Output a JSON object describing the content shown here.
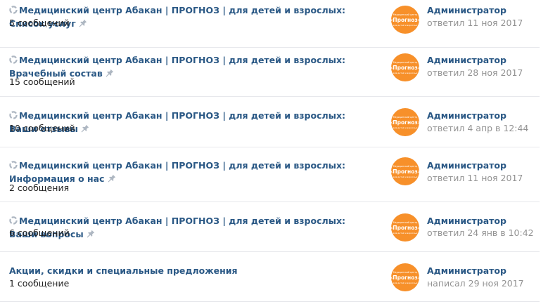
{
  "topics": [
    {
      "title": "Медицинский центр Абакан | ПРОГНОЗ | для детей и взрослых: Список услуг",
      "count": "5 сообщений",
      "author": "Администратор",
      "date": "ответил 11 ноя 2017",
      "has_poll_icon": true,
      "pinned": true
    },
    {
      "title": "Медицинский центр Абакан | ПРОГНОЗ | для детей и взрослых: Врачебный состав",
      "count": "15 сообщений",
      "author": "Администратор",
      "date": "ответил 28 ноя 2017",
      "has_poll_icon": true,
      "pinned": true
    },
    {
      "title": "Медицинский центр Абакан | ПРОГНОЗ | для детей и взрослых: Ваши отзывы",
      "count": "10 сообщений",
      "author": "Администратор",
      "date": "ответил 4 апр в 12:44",
      "has_poll_icon": true,
      "pinned": true
    },
    {
      "title": "Медицинский центр Абакан | ПРОГНОЗ | для детей и взрослых: Информация о нас",
      "count": "2 сообщения",
      "author": "Администратор",
      "date": "ответил 11 ноя 2017",
      "has_poll_icon": true,
      "pinned": true
    },
    {
      "title": "Медицинский центр Абакан | ПРОГНОЗ | для детей и взрослых: Ваши вопросы",
      "count": "6 сообщений",
      "author": "Администратор",
      "date": "ответил 24 янв в 10:42",
      "has_poll_icon": true,
      "pinned": true
    },
    {
      "title": "Акции, скидки и специальные предложения",
      "count": "1 сообщение",
      "author": "Администратор",
      "date": "написал 29 ноя 2017",
      "has_poll_icon": false,
      "pinned": false
    }
  ],
  "avatar": {
    "top_text": "Медицинский центр",
    "brand_text": "«Прогноз»",
    "bottom_text": "для детей и взрослых"
  },
  "colors": {
    "link": "#2a5885",
    "muted": "#939393",
    "text": "#222222",
    "divider": "#e7e8ec",
    "avatar_bg": "#f7902a",
    "icon": "#aeb7c2"
  },
  "icons": {
    "poll": "recycle-poll-icon",
    "pin": "pin-icon"
  }
}
